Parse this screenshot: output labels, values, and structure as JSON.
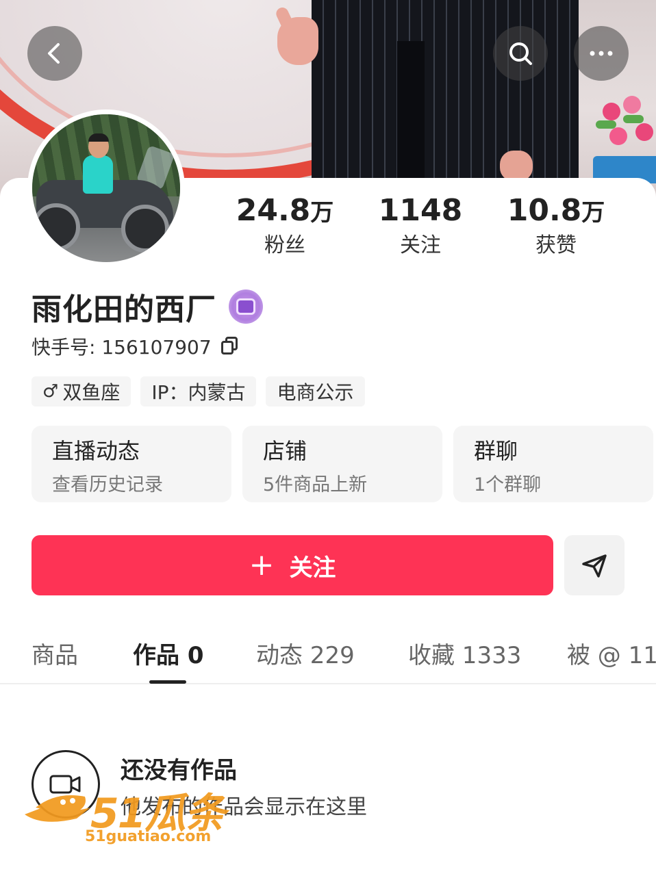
{
  "stats": {
    "fans": {
      "num": "24.8",
      "unit": "万",
      "label": "粉丝"
    },
    "following": {
      "num": "1148",
      "unit": "",
      "label": "关注"
    },
    "likes": {
      "num": "10.8",
      "unit": "万",
      "label": "获赞"
    }
  },
  "profile": {
    "name": "雨化田的西厂",
    "id_text": "快手号: 156107907"
  },
  "tags": [
    "双鱼座",
    "IP：内蒙古",
    "电商公示"
  ],
  "tag_gender_symbol": "♂",
  "shortcuts": [
    {
      "title": "直播动态",
      "sub": "查看历史记录"
    },
    {
      "title": "店铺",
      "sub": "5件商品上新"
    },
    {
      "title": "群聊",
      "sub": "1个群聊"
    }
  ],
  "follow_button": {
    "plus": "+",
    "label": "关注"
  },
  "tabs": [
    {
      "label": "商品"
    },
    {
      "label": "作品 0"
    },
    {
      "label": "动态 229"
    },
    {
      "label": "收藏 1333"
    },
    {
      "label": "被 @ 11"
    }
  ],
  "empty_state": {
    "title": "还没有作品",
    "subtitle": "他发布的作品会显示在这里"
  },
  "watermark": {
    "text": "51瓜条",
    "url": "51guatiao.com"
  },
  "colors": {
    "follow_button": "#fe3355",
    "tag_bg": "#f5f5f5",
    "watermark": "#f29a1f"
  },
  "icons": [
    "back-icon",
    "search-icon",
    "more-icon",
    "copy-icon",
    "share-icon",
    "video-camera-icon",
    "verified-badge-icon"
  ]
}
